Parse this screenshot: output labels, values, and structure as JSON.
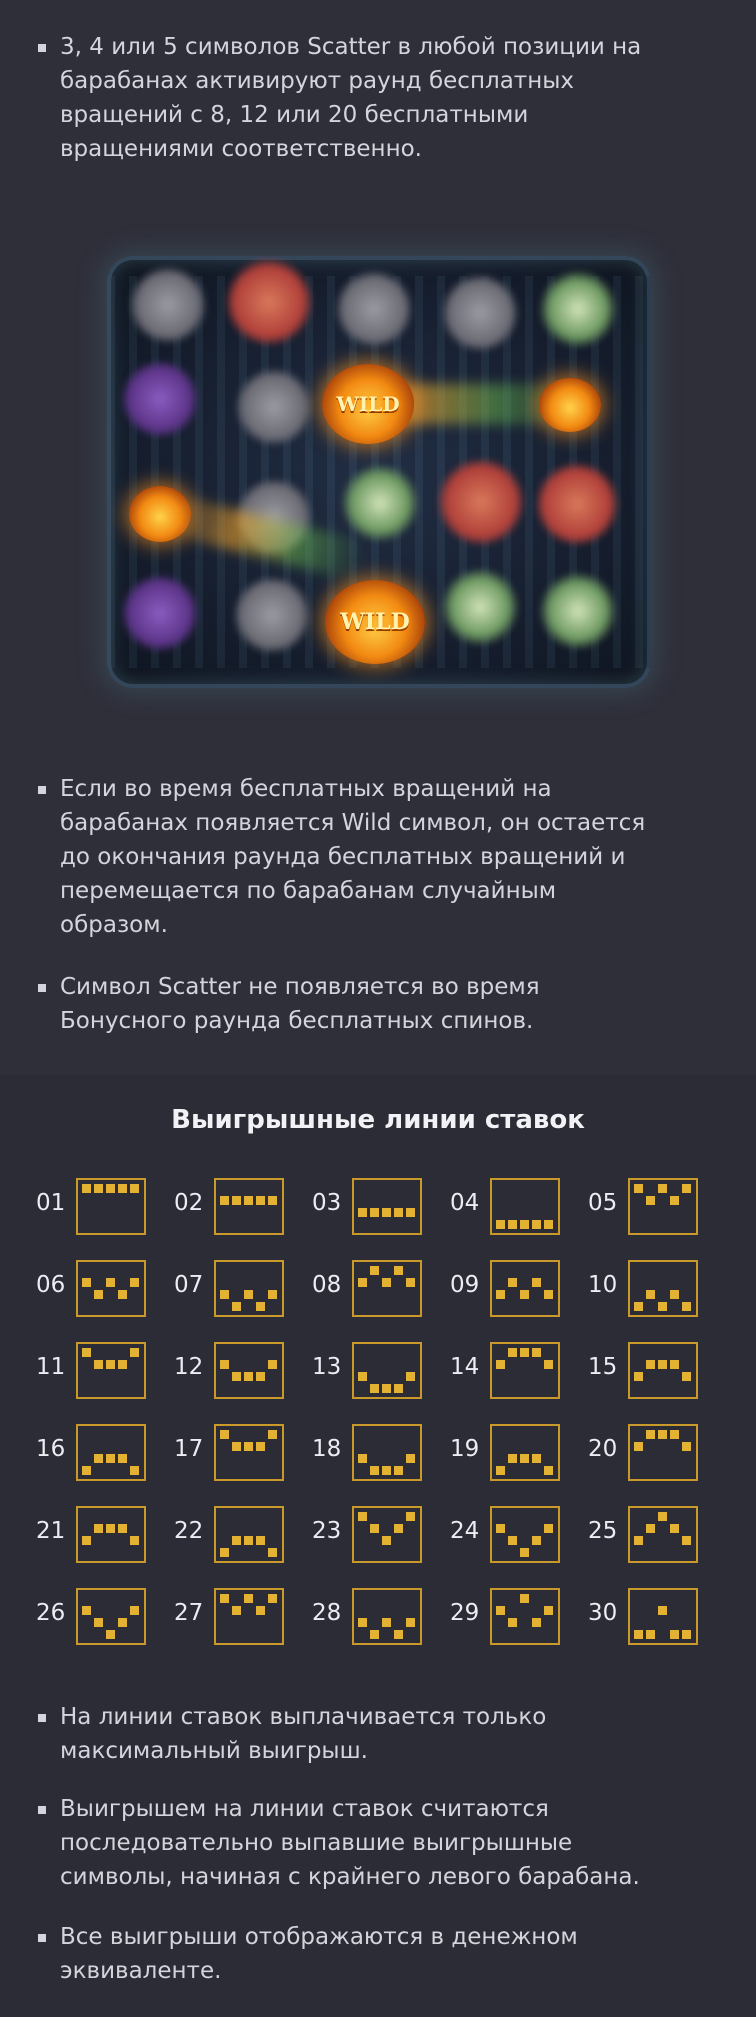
{
  "intro": {
    "bullet1": "3, 4 или 5 символов Scatter в любой позиции на\nбарабанах активируют раунд бесплатных\nвращений с 8, 12 или 20 бесплатными\nвращениями соответственно."
  },
  "game_image": {
    "wild_label": "WILD",
    "wild_label_2": "WILD"
  },
  "rules": {
    "bullet2": "Если во время бесплатных вращений на\nбарабанах появляется Wild символ, он остается\nдо окончания раунда бесплатных вращений и\nперемещается по барабанам случайным\nобразом.",
    "bullet3": "Символ Scatter не появляется во время\nБонусного раунда бесплатных спинов."
  },
  "paylines": {
    "title": "Выигрышные линии ставок",
    "lines": [
      {
        "num": "01",
        "rows": [
          0,
          0,
          0,
          0,
          0
        ]
      },
      {
        "num": "02",
        "rows": [
          1,
          1,
          1,
          1,
          1
        ]
      },
      {
        "num": "03",
        "rows": [
          2,
          2,
          2,
          2,
          2
        ]
      },
      {
        "num": "04",
        "rows": [
          3,
          3,
          3,
          3,
          3
        ]
      },
      {
        "num": "05",
        "rows": [
          0,
          1,
          0,
          1,
          0
        ]
      },
      {
        "num": "06",
        "rows": [
          1,
          2,
          1,
          2,
          1
        ]
      },
      {
        "num": "07",
        "rows": [
          2,
          3,
          2,
          3,
          2
        ]
      },
      {
        "num": "08",
        "rows": [
          1,
          0,
          1,
          0,
          1
        ]
      },
      {
        "num": "09",
        "rows": [
          2,
          1,
          2,
          1,
          2
        ]
      },
      {
        "num": "10",
        "rows": [
          3,
          2,
          3,
          2,
          3
        ]
      },
      {
        "num": "11",
        "rows": [
          0,
          1,
          1,
          1,
          0
        ]
      },
      {
        "num": "12",
        "rows": [
          1,
          2,
          2,
          2,
          1
        ]
      },
      {
        "num": "13",
        "rows": [
          2,
          3,
          3,
          3,
          2
        ]
      },
      {
        "num": "14",
        "rows": [
          1,
          0,
          0,
          0,
          1
        ]
      },
      {
        "num": "15",
        "rows": [
          2,
          1,
          1,
          1,
          2
        ]
      },
      {
        "num": "16",
        "rows": [
          3,
          2,
          2,
          2,
          3
        ]
      },
      {
        "num": "17",
        "rows": [
          0,
          1,
          1,
          1,
          0
        ]
      },
      {
        "num": "18",
        "rows": [
          2,
          3,
          3,
          3,
          2
        ]
      },
      {
        "num": "19",
        "rows": [
          3,
          2,
          2,
          2,
          3
        ]
      },
      {
        "num": "20",
        "rows": [
          1,
          0,
          0,
          0,
          1
        ]
      },
      {
        "num": "21",
        "rows": [
          2,
          1,
          1,
          1,
          2
        ]
      },
      {
        "num": "22",
        "rows": [
          3,
          2,
          2,
          2,
          3
        ]
      },
      {
        "num": "23",
        "rows": [
          0,
          1,
          2,
          1,
          0
        ]
      },
      {
        "num": "24",
        "rows": [
          1,
          2,
          3,
          2,
          1
        ]
      },
      {
        "num": "25",
        "rows": [
          2,
          1,
          0,
          1,
          2
        ]
      },
      {
        "num": "26",
        "rows": [
          1,
          2,
          3,
          2,
          1
        ]
      },
      {
        "num": "27",
        "rows": [
          0,
          1,
          0,
          1,
          0
        ]
      },
      {
        "num": "28",
        "rows": [
          2,
          3,
          2,
          3,
          2
        ]
      },
      {
        "num": "29",
        "rows": [
          1,
          2,
          0,
          2,
          1
        ]
      },
      {
        "num": "30",
        "rows": [
          3,
          3,
          1,
          3,
          3
        ]
      }
    ]
  },
  "footer": {
    "bullet4": "На линии ставок выплачивается только\nмаксимальный выигрыш.",
    "bullet5": "Выигрышем на линии ставок считаются\nпоследовательно выпавшие выигрышные\nсимволы, начиная с крайнего левого барабана.",
    "bullet6": "Все выигрыши отображаются в денежном\nэквиваленте."
  },
  "colors": {
    "background": "#2f2f3a",
    "accent": "#e3b233",
    "frame": "#c99a2a"
  }
}
